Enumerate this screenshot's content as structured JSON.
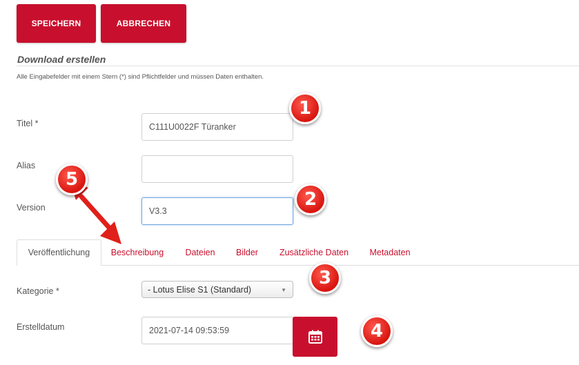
{
  "toolbar": {
    "save_label": "SPEICHERN",
    "cancel_label": "ABBRECHEN"
  },
  "form": {
    "section_title": "Download erstellen",
    "required_hint": "Alle Eingabefelder mit einem Stern (*) sind Pflichtfelder und müssen Daten enthalten.",
    "title": {
      "label": "Titel *",
      "value": "C111U0022F Türanker"
    },
    "alias": {
      "label": "Alias",
      "value": ""
    },
    "version": {
      "label": "Version",
      "value": "V3.3"
    }
  },
  "tabs": [
    {
      "label": "Veröffentlichung",
      "active": true
    },
    {
      "label": "Beschreibung",
      "active": false
    },
    {
      "label": "Dateien",
      "active": false
    },
    {
      "label": "Bilder",
      "active": false
    },
    {
      "label": "Zusätzliche Daten",
      "active": false
    },
    {
      "label": "Metadaten",
      "active": false
    }
  ],
  "publishing": {
    "category": {
      "label": "Kategorie *",
      "selected": "- Lotus Elise S1 (Standard)"
    },
    "created_date": {
      "label": "Erstelldatum",
      "value": "2021-07-14 09:53:59",
      "button_icon": "calendar-icon"
    }
  },
  "annotations": [
    "1",
    "2",
    "3",
    "4",
    "5"
  ],
  "colors": {
    "brand": "#c8102e",
    "marker": "#e0201a",
    "focus": "#6fa8dc"
  }
}
